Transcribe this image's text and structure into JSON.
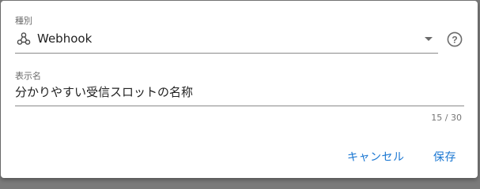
{
  "type_field": {
    "label": "種別",
    "value": "Webhook",
    "icon": "webhook-icon",
    "help_icon": "help-circle-icon"
  },
  "name_field": {
    "label": "表示名",
    "value": "分かりやすい受信スロットの名称",
    "counter": "15 / 30"
  },
  "actions": {
    "cancel_label": "キャンセル",
    "save_label": "保存"
  },
  "colors": {
    "accent": "#1976d2",
    "text": "#212121",
    "label": "#6b6b6b"
  }
}
